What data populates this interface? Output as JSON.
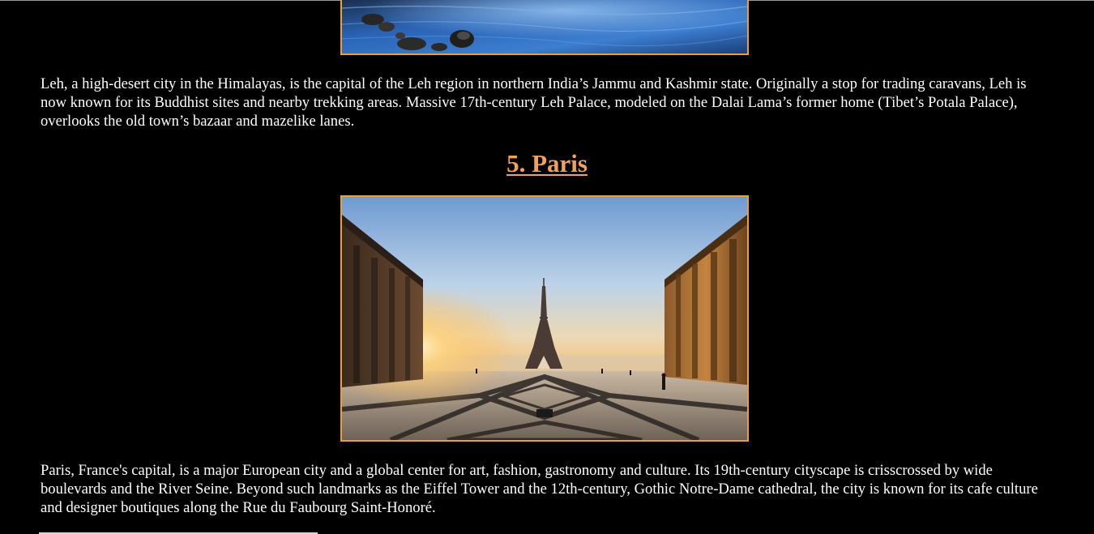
{
  "leh": {
    "image_alt": "Leh river photo",
    "description": "Leh, a high-desert city in the Himalayas, is the capital of the Leh region in northern India’s Jammu and Kashmir state. Originally a stop for trading caravans, Leh is now known for its Buddhist sites and nearby trekking areas. Massive 17th-century Leh Palace, modeled on the Dalai Lama’s former home (Tibet’s Potala Palace), overlooks the old town’s bazaar and mazelike lanes."
  },
  "paris": {
    "heading": "5. Paris",
    "image_alt": "Eiffel Tower from Trocadéro",
    "description": "Paris, France's capital, is a major European city and a global center for art, fashion, gastronomy and culture. Its 19th-century cityscape is crisscrossed by wide boulevards and the River Seine. Beyond such landmarks as the Eiffel Tower and the 12th-century, Gothic Notre-Dame cathedral, the city is known for its cafe culture and designer boutiques along the Rue du Faubourg Saint-Honoré."
  },
  "colors": {
    "background": "#000000",
    "text": "#ffffff",
    "heading_link": "#f2a15a",
    "image_border": "#e8a03a"
  }
}
